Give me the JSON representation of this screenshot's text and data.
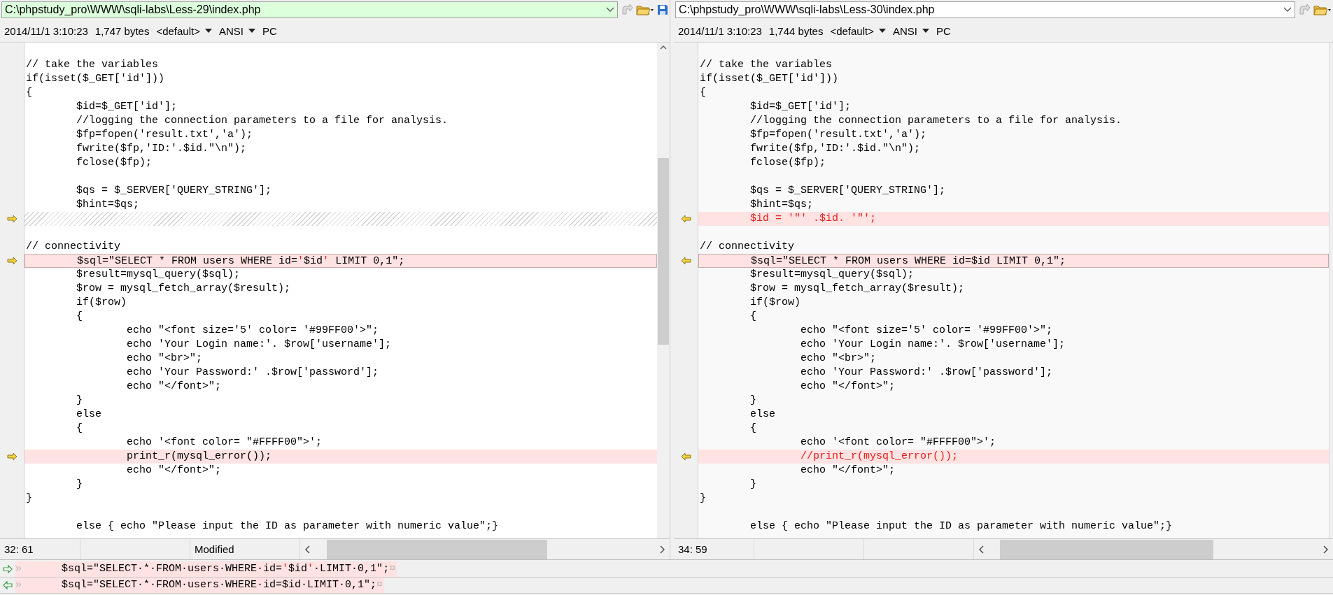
{
  "panes": [
    {
      "kind": "left",
      "active": true,
      "path": "C:\\phpstudy_pro\\WWW\\sqli-labs\\Less-29\\index.php",
      "date": "2014/11/1 3:10:23",
      "size": "1,747 bytes",
      "codepage": "<default>",
      "encoding": "ANSI",
      "eol": "PC",
      "position": "32: 61",
      "state": "Modified",
      "lines": [
        {
          "kind": "blank"
        },
        {
          "kind": "same",
          "text": "// take the variables"
        },
        {
          "kind": "same",
          "text": "if(isset($_GET['id']))"
        },
        {
          "kind": "same",
          "text": "{"
        },
        {
          "kind": "same",
          "text": "\t$id=$_GET['id'];"
        },
        {
          "kind": "same",
          "text": "\t//logging the connection parameters to a file for analysis."
        },
        {
          "kind": "same",
          "text": "\t$fp=fopen('result.txt','a');"
        },
        {
          "kind": "same",
          "text": "\tfwrite($fp,'ID:'.$id.\"\\n\");"
        },
        {
          "kind": "same",
          "text": "\tfclose($fp);"
        },
        {
          "kind": "blank"
        },
        {
          "kind": "same",
          "text": "\t$qs = $_SERVER['QUERY_STRING'];"
        },
        {
          "kind": "same",
          "text": "\t$hint=$qs;"
        },
        {
          "kind": "missing"
        },
        {
          "kind": "blank"
        },
        {
          "kind": "same",
          "text": "// connectivity"
        },
        {
          "kind": "changed",
          "current": true,
          "parts": [
            {
              "text": "\t$sql=\"SELECT * FROM users WHERE id=",
              "diff": false
            },
            {
              "text": "'",
              "diff": true
            },
            {
              "text": "$id",
              "diff": false
            },
            {
              "text": "'",
              "diff": true
            },
            {
              "text": " LIMIT 0,1\";",
              "diff": false
            }
          ]
        },
        {
          "kind": "same",
          "text": "\t$result=mysql_query($sql);"
        },
        {
          "kind": "same",
          "text": "\t$row = mysql_fetch_array($result);"
        },
        {
          "kind": "same",
          "text": "\tif($row)"
        },
        {
          "kind": "same",
          "text": "\t{"
        },
        {
          "kind": "same",
          "text": "\t\techo \"<font size='5' color= '#99FF00'>\";"
        },
        {
          "kind": "same",
          "text": "\t\techo 'Your Login name:'. $row['username'];"
        },
        {
          "kind": "same",
          "text": "\t\techo \"<br>\";"
        },
        {
          "kind": "same",
          "text": "\t\techo 'Your Password:' .$row['password'];"
        },
        {
          "kind": "same",
          "text": "\t\techo \"</font>\";"
        },
        {
          "kind": "same",
          "text": "\t}"
        },
        {
          "kind": "same",
          "text": "\telse"
        },
        {
          "kind": "same",
          "text": "\t{"
        },
        {
          "kind": "same",
          "text": "\t\techo '<font color= \"#FFFF00\">';"
        },
        {
          "kind": "changed",
          "current": false,
          "parts": [
            {
              "text": "\t\tprint_r(mysql_error());",
              "diff": false
            }
          ]
        },
        {
          "kind": "same",
          "text": "\t\techo \"</font>\";"
        },
        {
          "kind": "same",
          "text": "\t}"
        },
        {
          "kind": "same",
          "text": "}"
        },
        {
          "kind": "blank"
        },
        {
          "kind": "same",
          "text": "\telse { echo \"Please input the ID as parameter with numeric value\";}"
        }
      ]
    },
    {
      "kind": "right",
      "active": false,
      "path": "C:\\phpstudy_pro\\WWW\\sqli-labs\\Less-30\\index.php",
      "date": "2014/11/1 3:10:23",
      "size": "1,744 bytes",
      "codepage": "<default>",
      "encoding": "ANSI",
      "eol": "PC",
      "position": "34: 59",
      "lines": [
        {
          "kind": "blank"
        },
        {
          "kind": "same",
          "text": "// take the variables"
        },
        {
          "kind": "same",
          "text": "if(isset($_GET['id']))"
        },
        {
          "kind": "same",
          "text": "{"
        },
        {
          "kind": "same",
          "text": "\t$id=$_GET['id'];"
        },
        {
          "kind": "same",
          "text": "\t//logging the connection parameters to a file for analysis."
        },
        {
          "kind": "same",
          "text": "\t$fp=fopen('result.txt','a');"
        },
        {
          "kind": "same",
          "text": "\tfwrite($fp,'ID:'.$id.\"\\n\");"
        },
        {
          "kind": "same",
          "text": "\tfclose($fp);"
        },
        {
          "kind": "blank"
        },
        {
          "kind": "same",
          "text": "\t$qs = $_SERVER['QUERY_STRING'];"
        },
        {
          "kind": "same",
          "text": "\t$hint=$qs;"
        },
        {
          "kind": "changed",
          "current": false,
          "parts": [
            {
              "text": "\t$id = '\"' .$id. '\"';",
              "diff": true
            }
          ]
        },
        {
          "kind": "blank"
        },
        {
          "kind": "same",
          "text": "// connectivity"
        },
        {
          "kind": "changed",
          "current": true,
          "parts": [
            {
              "text": "\t$sql=\"SELECT * FROM users WHERE id=$id LIMIT 0,1\";",
              "diff": false
            }
          ]
        },
        {
          "kind": "same",
          "text": "\t$result=mysql_query($sql);"
        },
        {
          "kind": "same",
          "text": "\t$row = mysql_fetch_array($result);"
        },
        {
          "kind": "same",
          "text": "\tif($row)"
        },
        {
          "kind": "same",
          "text": "\t{"
        },
        {
          "kind": "same",
          "text": "\t\techo \"<font size='5' color= '#99FF00'>\";"
        },
        {
          "kind": "same",
          "text": "\t\techo 'Your Login name:'. $row['username'];"
        },
        {
          "kind": "same",
          "text": "\t\techo \"<br>\";"
        },
        {
          "kind": "same",
          "text": "\t\techo 'Your Password:' .$row['password'];"
        },
        {
          "kind": "same",
          "text": "\t\techo \"</font>\";"
        },
        {
          "kind": "same",
          "text": "\t}"
        },
        {
          "kind": "same",
          "text": "\telse"
        },
        {
          "kind": "same",
          "text": "\t{"
        },
        {
          "kind": "same",
          "text": "\t\techo '<font color= \"#FFFF00\">';"
        },
        {
          "kind": "changed",
          "current": false,
          "parts": [
            {
              "text": "\t\t//print_r(mysql_error());",
              "diff": true
            }
          ]
        },
        {
          "kind": "same",
          "text": "\t\techo \"</font>\";"
        },
        {
          "kind": "same",
          "text": "\t}"
        },
        {
          "kind": "same",
          "text": "}"
        },
        {
          "kind": "blank"
        },
        {
          "kind": "same",
          "text": "\telse { echo \"Please input the ID as parameter with numeric value\";}"
        }
      ]
    }
  ],
  "detail": [
    {
      "kind": "left",
      "parts": [
        {
          "text": "»",
          "kind": "mark"
        },
        {
          "text": "$sql=\"SELECT·*·FROM·users·WHERE·id=",
          "kind": "plain"
        },
        {
          "text": "'",
          "kind": "diff"
        },
        {
          "text": "$id",
          "kind": "plain"
        },
        {
          "text": "'",
          "kind": "diff"
        },
        {
          "text": "·LIMIT·0,1\";",
          "kind": "plain"
        },
        {
          "text": "¤",
          "kind": "mark"
        }
      ]
    },
    {
      "kind": "right",
      "parts": [
        {
          "text": "»",
          "kind": "mark"
        },
        {
          "text": "$sql=\"SELECT·*·FROM·users·WHERE·id=$id·LIMIT·0,1\";",
          "kind": "plain"
        },
        {
          "text": "¤",
          "kind": "mark"
        }
      ]
    }
  ]
}
